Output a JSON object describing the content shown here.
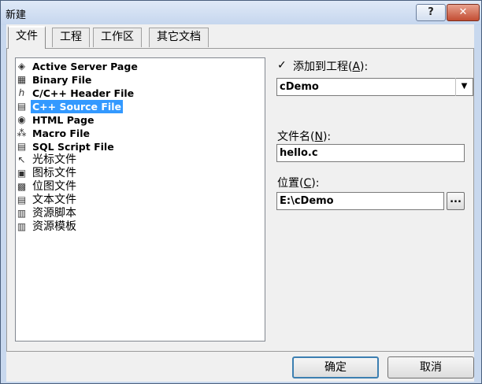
{
  "window": {
    "title": "新建",
    "help_label": "?",
    "close_label": "✕"
  },
  "tabs": [
    {
      "label": "文件",
      "active": true
    },
    {
      "label": "工程",
      "active": false
    },
    {
      "label": "工作区",
      "active": false
    },
    {
      "label": "其它文档",
      "active": false
    }
  ],
  "files": [
    {
      "label": "Active Server Page",
      "icon": "asp-file-icon",
      "glyph": "◈"
    },
    {
      "label": "Binary File",
      "icon": "binary-file-icon",
      "glyph": "▦"
    },
    {
      "label": "C/C++ Header File",
      "icon": "header-file-icon",
      "glyph": "ℎ"
    },
    {
      "label": "C++ Source File",
      "icon": "cpp-source-file-icon",
      "glyph": "▤",
      "selected": true
    },
    {
      "label": "HTML Page",
      "icon": "html-page-icon",
      "glyph": "◉"
    },
    {
      "label": "Macro File",
      "icon": "macro-file-icon",
      "glyph": "⁂"
    },
    {
      "label": "SQL Script File",
      "icon": "sql-script-icon",
      "glyph": "▤"
    },
    {
      "label": "光标文件",
      "icon": "cursor-file-icon",
      "glyph": "↖"
    },
    {
      "label": "图标文件",
      "icon": "icon-file-icon",
      "glyph": "▣"
    },
    {
      "label": "位图文件",
      "icon": "bitmap-file-icon",
      "glyph": "▩"
    },
    {
      "label": "文本文件",
      "icon": "text-file-icon",
      "glyph": "▤"
    },
    {
      "label": "资源脚本",
      "icon": "resource-script-icon",
      "glyph": "▥"
    },
    {
      "label": "资源模板",
      "icon": "resource-template-icon",
      "glyph": "▥"
    }
  ],
  "add_to_project": {
    "checked": true,
    "check_glyph": "✓",
    "label": "添加到工程",
    "accel": "A",
    "paren_open": "(",
    "paren_close": "):",
    "value": "cDemo"
  },
  "filename": {
    "label": "文件名",
    "accel": "N",
    "paren_open": "(",
    "paren_close": "):",
    "value": "hello.c"
  },
  "location": {
    "label": "位置",
    "accel": "C",
    "paren_open": "(",
    "paren_close": "):",
    "value": "E:\\cDemo",
    "browse_label": "..."
  },
  "buttons": {
    "ok": "确定",
    "cancel": "取消"
  },
  "colors": {
    "selection": "#3399ff",
    "dialog_bg": "#f0f0f0"
  }
}
